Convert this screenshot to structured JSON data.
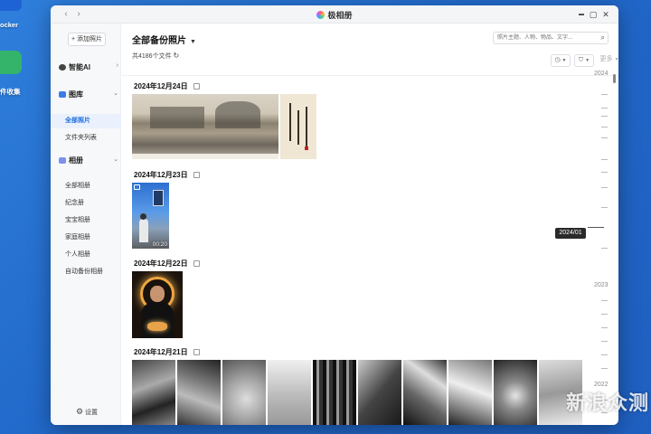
{
  "desktop": {
    "items": [
      {
        "label": "ocker",
        "icon": "docker-icon",
        "color": "#1e63d6"
      },
      {
        "label": "件收集",
        "icon": "file-collection-icon",
        "color": "#34b36b"
      }
    ]
  },
  "window": {
    "title": "极相册",
    "controls": {
      "minimize": "▬",
      "maximize": "▢",
      "close": "✕"
    },
    "nav": {
      "back": "‹",
      "forward": "›"
    }
  },
  "sidebar": {
    "add_button": "+ 添加照片",
    "sections": [
      {
        "label": "智能AI",
        "icon": "ai-icon",
        "arrow": "›"
      },
      {
        "label": "图库",
        "icon": "gallery-icon",
        "arrow": "⌄"
      },
      {
        "label": "相册",
        "icon": "album-icon",
        "arrow": "⌄"
      }
    ],
    "gallery_items": [
      "全部照片",
      "文件夹列表"
    ],
    "album_items": [
      "全部相册",
      "纪念册",
      "宝宝相册",
      "家庭相册",
      "个人相册",
      "自动备份相册"
    ],
    "settings": "设置"
  },
  "main": {
    "title": "全部备份照片",
    "count": "共4186个文件",
    "search_placeholder": "照片主题、人物、物品、文字...",
    "tools": {
      "more": "更多"
    },
    "groups": [
      {
        "date": "2024年12月24日"
      },
      {
        "date": "2024年12月23日",
        "video_duration": "00:20"
      },
      {
        "date": "2024年12月22日"
      },
      {
        "date": "2024年12月21日"
      }
    ]
  },
  "timeline": {
    "years": [
      "2024",
      "2023",
      "2022"
    ],
    "current": "2024/01"
  },
  "watermark": "新浪众测",
  "colors": {
    "accent": "#1e6fe0",
    "desktop": "#2168c9"
  }
}
